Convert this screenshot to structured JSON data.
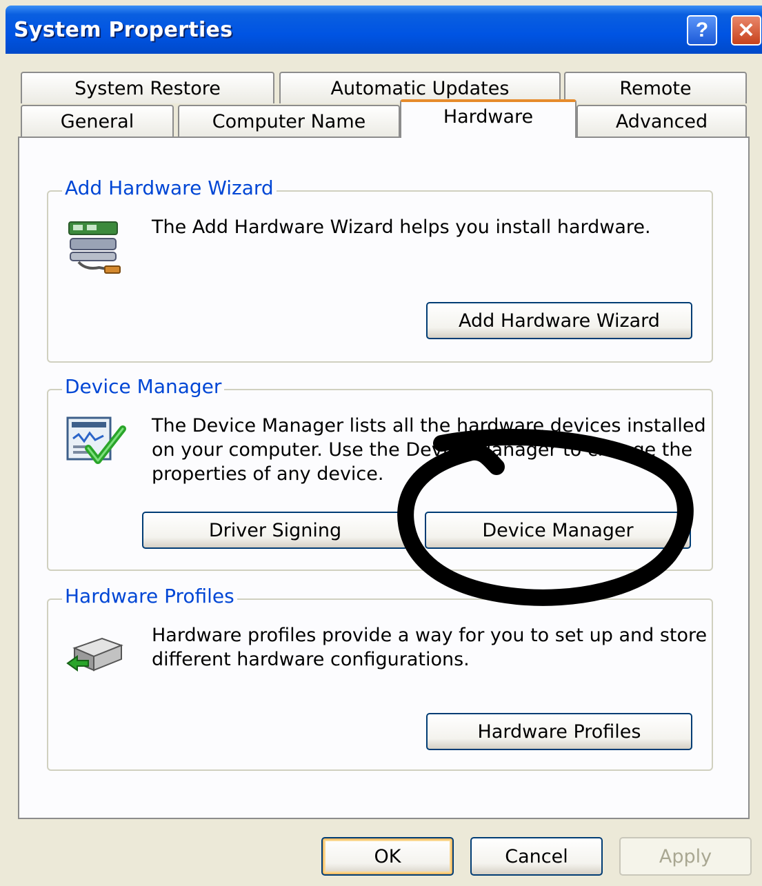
{
  "window": {
    "title": "System Properties",
    "help_glyph": "?",
    "close_glyph": "✕"
  },
  "tabs_row1": [
    {
      "label": "System Restore"
    },
    {
      "label": "Automatic Updates"
    },
    {
      "label": "Remote"
    }
  ],
  "tabs_row2": [
    {
      "label": "General"
    },
    {
      "label": "Computer Name"
    },
    {
      "label": "Hardware",
      "active": true
    },
    {
      "label": "Advanced"
    }
  ],
  "groups": {
    "add_hardware": {
      "legend": "Add Hardware Wizard",
      "description": "The Add Hardware Wizard helps you install hardware.",
      "button": "Add Hardware Wizard",
      "icon": "hardware-wizard-icon"
    },
    "device_manager": {
      "legend": "Device Manager",
      "description_lines": [
        "The Device Manager lists all the hardware devices installed",
        "on your computer. Use the Device Manager to change the",
        "properties of any device."
      ],
      "button_driver_signing": "Driver Signing",
      "button_device_manager": "Device Manager",
      "icon": "device-manager-icon"
    },
    "hardware_profiles": {
      "legend": "Hardware Profiles",
      "description_lines": [
        "Hardware profiles provide a way for you to set up and store",
        "different hardware configurations."
      ],
      "button": "Hardware Profiles",
      "icon": "hardware-profiles-icon"
    }
  },
  "footer": {
    "ok": "OK",
    "cancel": "Cancel",
    "apply": "Apply"
  },
  "colors": {
    "titlebar": "#0054e3",
    "dialog_bg": "#ECE9D8",
    "legend_text": "#0046d5",
    "active_tab_accent": "#e68b2c",
    "annotation": "#000000"
  }
}
